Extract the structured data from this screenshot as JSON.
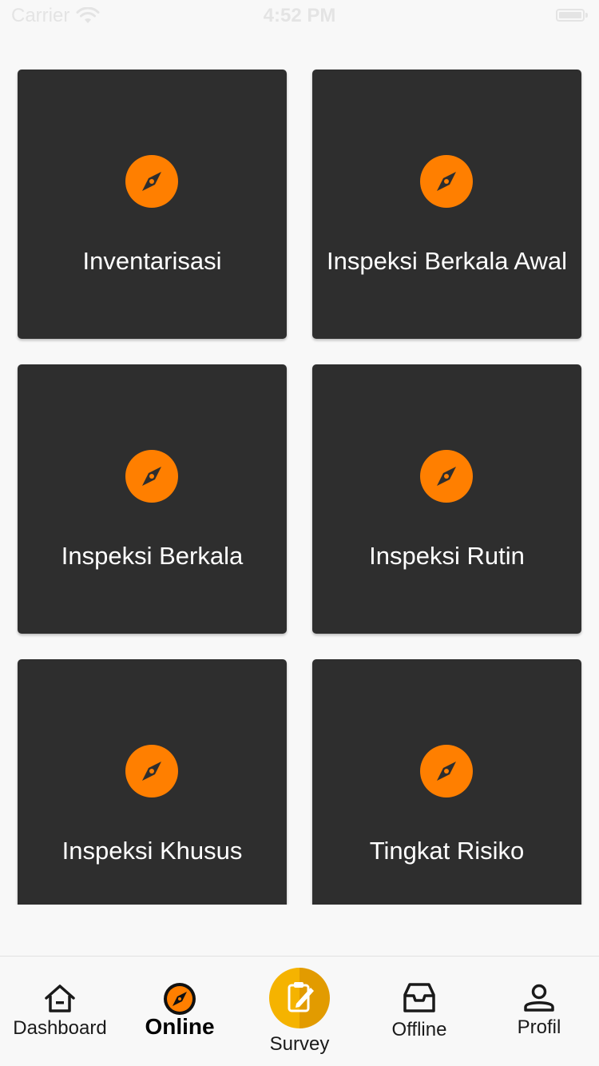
{
  "status_bar": {
    "carrier": "Carrier",
    "time": "4:52 PM"
  },
  "cards": [
    {
      "label": "Inventarisasi",
      "icon": "compass-icon"
    },
    {
      "label": "Inspeksi Berkala Awal",
      "icon": "compass-icon"
    },
    {
      "label": "Inspeksi Berkala",
      "icon": "compass-icon"
    },
    {
      "label": "Inspeksi Rutin",
      "icon": "compass-icon"
    },
    {
      "label": "Inspeksi Khusus",
      "icon": "compass-icon"
    },
    {
      "label": "Tingkat Risiko",
      "icon": "compass-icon"
    }
  ],
  "bottom_nav": {
    "items": [
      {
        "label": "Dashboard",
        "icon": "home-icon",
        "active": false
      },
      {
        "label": "Online",
        "icon": "compass-icon",
        "active": true
      },
      {
        "label": "Survey",
        "icon": "edit-clipboard-icon",
        "active": false
      },
      {
        "label": "Offline",
        "icon": "inbox-icon",
        "active": false
      },
      {
        "label": "Profil",
        "icon": "person-icon",
        "active": false
      }
    ]
  },
  "colors": {
    "card_background": "#2e2e2e",
    "accent_orange": "#ff7f00",
    "survey_yellow": "#f5b300",
    "page_background": "#f8f8f8"
  }
}
